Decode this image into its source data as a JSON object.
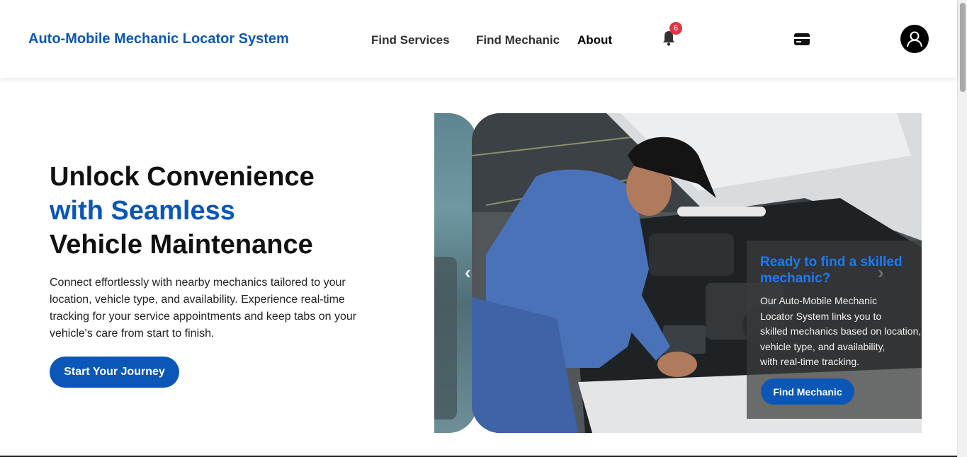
{
  "header": {
    "brand": "Auto-Mobile Mechanic Locator System",
    "nav": {
      "find_services": "Find Services",
      "find_mechanic": "Find Mechanic",
      "about": "About"
    },
    "notifications": {
      "icon": "bell-icon",
      "count": "6"
    },
    "payment_icon": "credit-card-icon",
    "profile_icon": "user-avatar-icon"
  },
  "hero": {
    "title_line1": "Unlock Convenience",
    "title_line2": "with Seamless",
    "title_line3": "Vehicle Maintenance",
    "description": "Connect effortlessly with nearby mechanics tailored to your location, vehicle type, and availability. Experience real-time tracking for your service appointments and keep tabs on your vehicle's care from start to finish.",
    "cta_label": "Start Your Journey"
  },
  "carousel": {
    "prev_arrow": "‹",
    "next_arrow": "›",
    "slide_title": "Ready to find a skilled mechanic?",
    "slide_text": "Our Auto-Mobile Mechanic\nLocator System links you to\nskilled mechanics based on location,\nvehicle type, and availability,\nwith real-time tracking.",
    "slide_button": "Find Mechanic"
  },
  "colors": {
    "brand_blue": "#0b57b7",
    "overlay_title_blue": "#1d7bf0",
    "badge_red": "#e03545"
  }
}
